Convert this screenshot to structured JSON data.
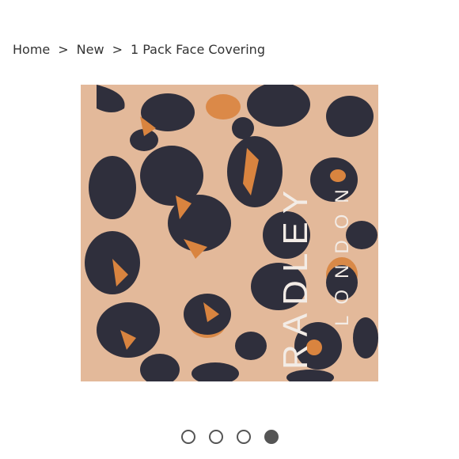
{
  "breadcrumb": {
    "items": [
      {
        "label": "Home"
      },
      {
        "label": "New"
      },
      {
        "label": "1 Pack Face Covering"
      }
    ],
    "separator": ">"
  },
  "product_image": {
    "pattern": "leopard-print",
    "brand_mark": "RADLEY",
    "brand_sub": "LONDON",
    "colors": {
      "base": "#e3b99a",
      "spot": "#2f2f3c",
      "inner": "#d9843f",
      "mark": "#f3ece6"
    }
  },
  "carousel": {
    "count": 4,
    "active_index": 3
  }
}
